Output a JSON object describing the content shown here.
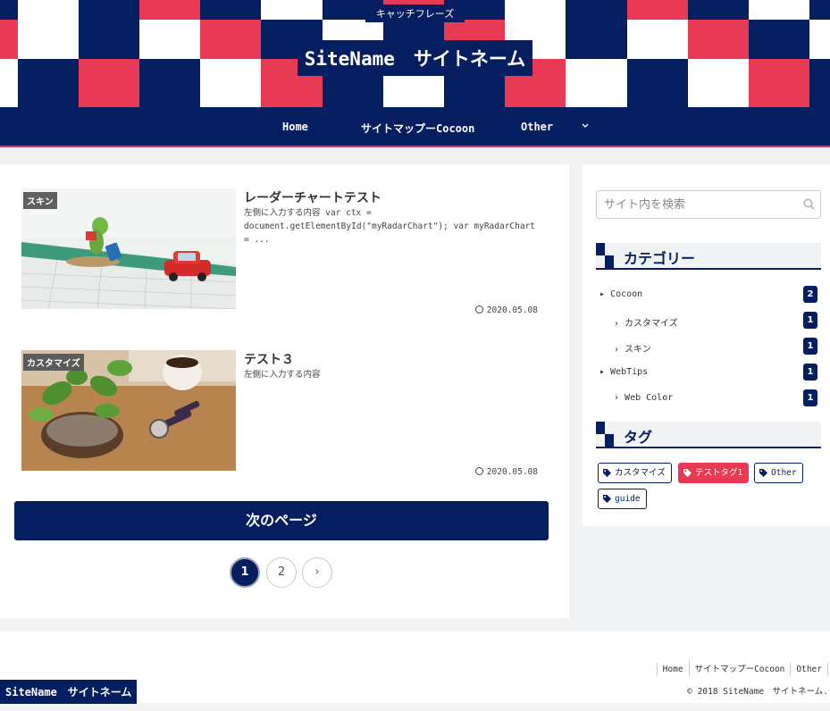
{
  "header": {
    "catchphrase": "キャッチフレーズ",
    "site_name": "SiteName　サイトネーム"
  },
  "nav": {
    "items": [
      {
        "label": "Home"
      },
      {
        "label": "サイトマップーCocoon"
      },
      {
        "label": "Other"
      }
    ]
  },
  "posts": [
    {
      "category": "スキン",
      "title": "レーダーチャートテスト",
      "snippet": "左側に入力する内容 var ctx = document.getElementById(\"myRadarChart\"); var myRadarChart = ...",
      "date": "2020.05.08",
      "thumbnail_icon": "frog-figure-map-photo"
    },
    {
      "category": "カスタマイズ",
      "title": "テスト３",
      "snippet": "左側に入力する内容",
      "date": "2020.05.08",
      "thumbnail_icon": "plant-coffee-watch-photo"
    }
  ],
  "pagination": {
    "next_label": "次のページ",
    "pages": [
      "1",
      "2"
    ],
    "current_page": "1",
    "next_icon": "›"
  },
  "sidebar": {
    "search_placeholder": "サイト内を検索",
    "categories_title": "カテゴリー",
    "categories": [
      {
        "label": "Cocoon",
        "count": "2",
        "level": 0
      },
      {
        "label": "カスタマイズ",
        "count": "1",
        "level": 1
      },
      {
        "label": "スキン",
        "count": "1",
        "level": 1
      },
      {
        "label": "WebTips",
        "count": "1",
        "level": 0
      },
      {
        "label": "Web Color",
        "count": "1",
        "level": 1
      }
    ],
    "tags_title": "タグ",
    "tags": [
      {
        "label": "カスタマイズ",
        "highlight": false
      },
      {
        "label": "テストタグ1",
        "highlight": true
      },
      {
        "label": "Other",
        "highlight": false
      },
      {
        "label": "guide",
        "highlight": false
      }
    ]
  },
  "footer": {
    "nav": [
      "Home",
      "サイトマップーCocoon",
      "Other"
    ],
    "site_name": "SiteName　サイトネーム",
    "copyright": "© 2018 SiteName　サイトネーム."
  },
  "colors": {
    "navy": "#041e5f",
    "accent_red": "#e83a55",
    "background": "#f2f3f5"
  }
}
